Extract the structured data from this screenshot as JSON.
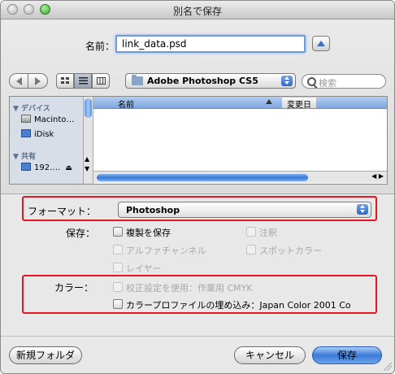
{
  "window": {
    "title": "別名で保存"
  },
  "save": {
    "name_label": "名前：",
    "filename": "link_data.psd"
  },
  "toolbar": {
    "location": "Adobe Photoshop CS5",
    "search_placeholder": "検索"
  },
  "sidebar": {
    "devices_header": "▼ デバイス",
    "devices": [
      "Macinto…",
      "iDisk"
    ],
    "shared_header": "▼ 共有",
    "shared": [
      "192…."
    ]
  },
  "list": {
    "columns": [
      "名前",
      "変更日"
    ]
  },
  "options": {
    "format_label": "フォーマット：",
    "format_value": "Photoshop",
    "save_label": "保存：",
    "save_options": [
      {
        "label": "複製を保存",
        "enabled": true
      },
      {
        "label": "注釈",
        "enabled": false
      },
      {
        "label": "アルファチャンネル",
        "enabled": false
      },
      {
        "label": "スポットカラー",
        "enabled": false
      },
      {
        "label": "レイヤー",
        "enabled": false
      }
    ],
    "color_label": "カラー：",
    "color_options": [
      {
        "label": "校正設定を使用：作業用 CMYK",
        "enabled": false
      },
      {
        "label": "カラープロファイルの埋め込み：Japan Color 2001 Co",
        "enabled": true
      }
    ]
  },
  "buttons": {
    "new_folder": "新規フォルダ",
    "cancel": "キャンセル",
    "save": "保存"
  },
  "colors": {
    "highlight": "#e8141e",
    "accent": "#3b7ad8"
  }
}
